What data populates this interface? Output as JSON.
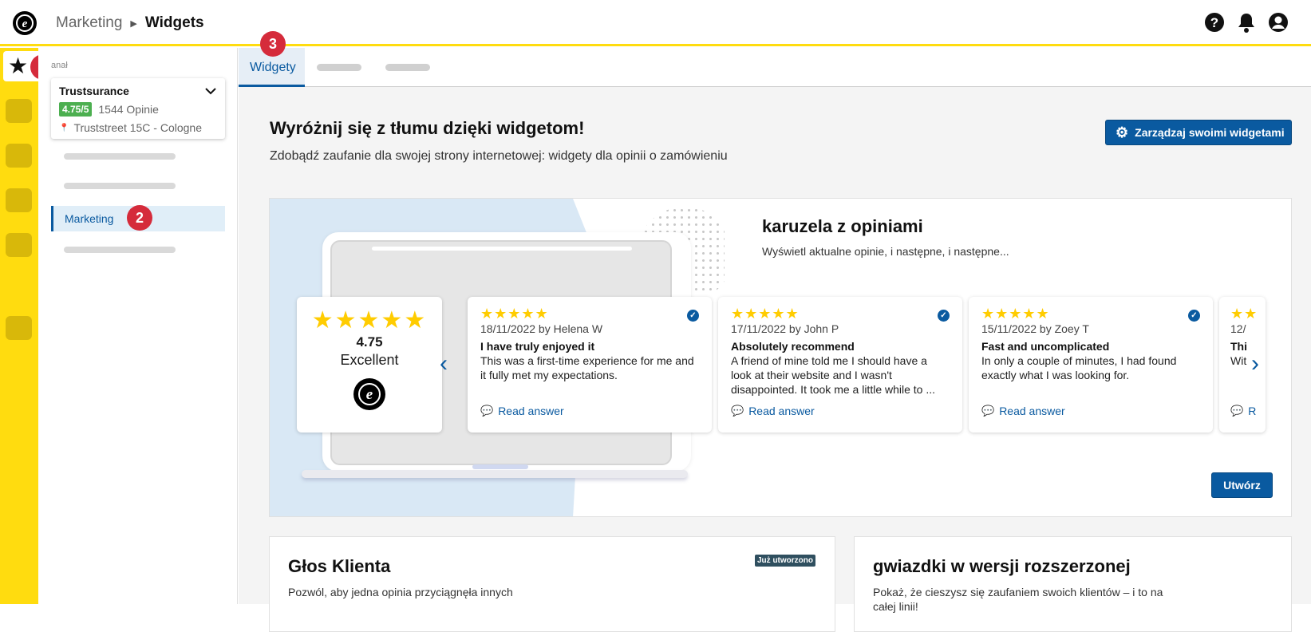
{
  "topbar": {
    "breadcrumb_parent": "Marketing",
    "breadcrumb_current": "Widgets"
  },
  "annotations": {
    "one": "1",
    "two": "2",
    "three": "3"
  },
  "sidebar": {
    "channel_label": "anał",
    "shop": {
      "name": "Trustsurance",
      "rating": "4.75/5",
      "reviews": "1544 Opinie",
      "address": "Truststreet 15C - Cologne"
    },
    "active_item": "Marketing"
  },
  "tabs": {
    "active": "Widgety"
  },
  "main": {
    "headline": "Wyróżnij się z tłumu dzięki widgetom!",
    "subline": "Zdobądź zaufanie dla swojej strony internetowej: widgety dla opinii o zamówieniu",
    "manage_button": "Zarządzaj swoimi widgetami"
  },
  "carousel": {
    "title": "karuzela z opiniami",
    "description": "Wyświetl aktualne opinie, i następne, i następne...",
    "summary": {
      "stars": "★★★★★",
      "score": "4.75",
      "label": "Excellent"
    },
    "reviews": [
      {
        "stars": "★★★★★",
        "meta": "18/11/2022 by Helena W",
        "title": "I have truly enjoyed it",
        "body": "This was a first-time experience for me and it fully met my expectations.",
        "link": "Read answer"
      },
      {
        "stars": "★★★★★",
        "meta": "17/11/2022 by John P",
        "title": "Absolutely recommend",
        "body": "A friend of mine told me I should have a look at their website and I wasn't disappointed. It took me a little while to ...",
        "link": "Read answer"
      },
      {
        "stars": "★★★★★",
        "meta": "15/11/2022 by Zoey T",
        "title": "Fast and uncomplicated",
        "body": "In only a couple of minutes, I had found exactly what I was looking for.",
        "link": "Read answer"
      },
      {
        "stars": "★★",
        "meta": "12/",
        "title": "Thi",
        "body": "Wit",
        "link": "R"
      }
    ],
    "create_button": "Utwórz"
  },
  "cards": [
    {
      "title": "Głos Klienta",
      "description": "Pozwól, aby jedna opinia przyciągnęła innych",
      "status": "Już utworzono"
    },
    {
      "title": "gwiazdki w wersji rozszerzonej",
      "description": "Pokaż, że cieszysz się zaufaniem swoich klientów – i to na całej linii!"
    }
  ],
  "colors": {
    "brand_yellow": "#ffdc0f",
    "primary_blue": "#0a5aa0",
    "annotation_red": "#d52b3b",
    "rating_green": "#4caf50",
    "star_yellow": "#ffcc00"
  }
}
